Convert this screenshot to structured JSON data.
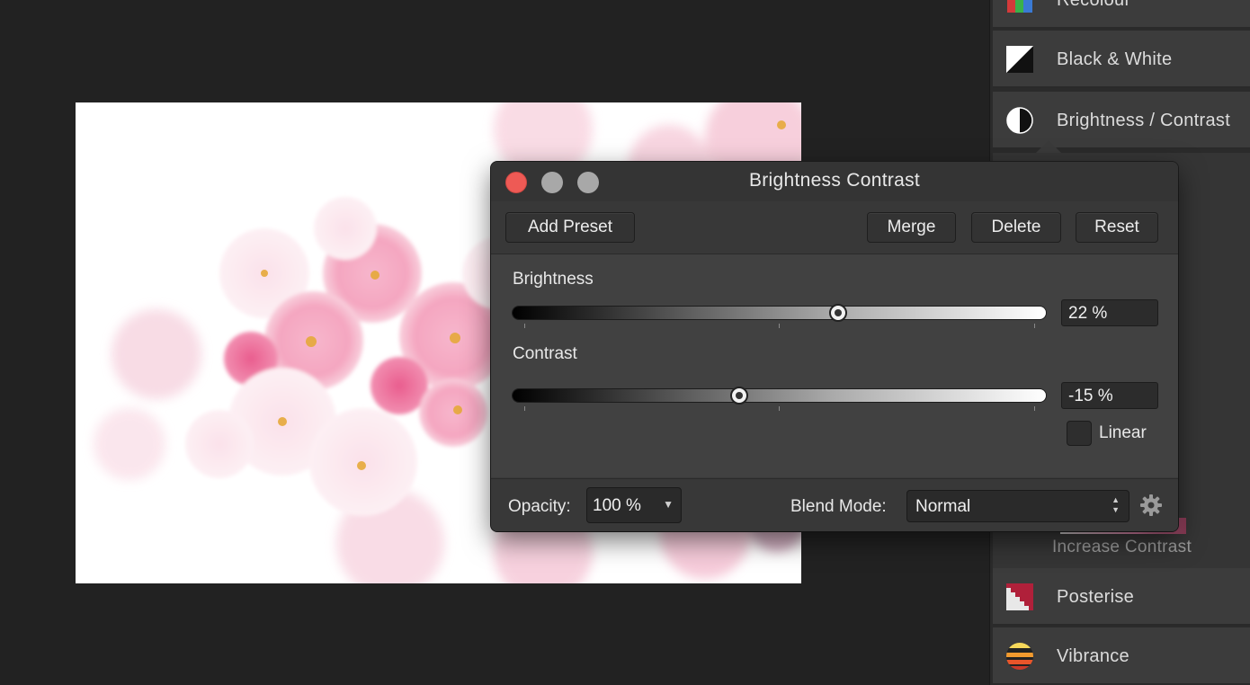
{
  "adjustments": {
    "items": [
      {
        "label": "Recolour",
        "icon": "recolour-icon"
      },
      {
        "label": "Black & White",
        "icon": "black-white-icon"
      },
      {
        "label": "Brightness / Contrast",
        "icon": "brightness-contrast-icon"
      },
      {
        "label": "Posterise",
        "icon": "posterise-icon"
      },
      {
        "label": "Vibrance",
        "icon": "vibrance-icon"
      }
    ],
    "preset_caption": "Increase Contrast"
  },
  "dialog": {
    "title": "Brightness Contrast",
    "toolbar": {
      "add_preset": "Add Preset",
      "merge": "Merge",
      "delete": "Delete",
      "reset": "Reset"
    },
    "brightness": {
      "label": "Brightness",
      "display": "22 %",
      "value": 22,
      "min": -100,
      "max": 100
    },
    "contrast": {
      "label": "Contrast",
      "display": "-15 %",
      "value": -15,
      "min": -100,
      "max": 100
    },
    "linear": {
      "label": "Linear",
      "checked": false
    },
    "footer": {
      "opacity_label": "Opacity:",
      "opacity_value": "100 %",
      "blend_label": "Blend Mode:",
      "blend_value": "Normal"
    }
  },
  "colors": {
    "close_button": "#ee5a55",
    "background": "#222222",
    "panel": "#3c3c3c"
  }
}
